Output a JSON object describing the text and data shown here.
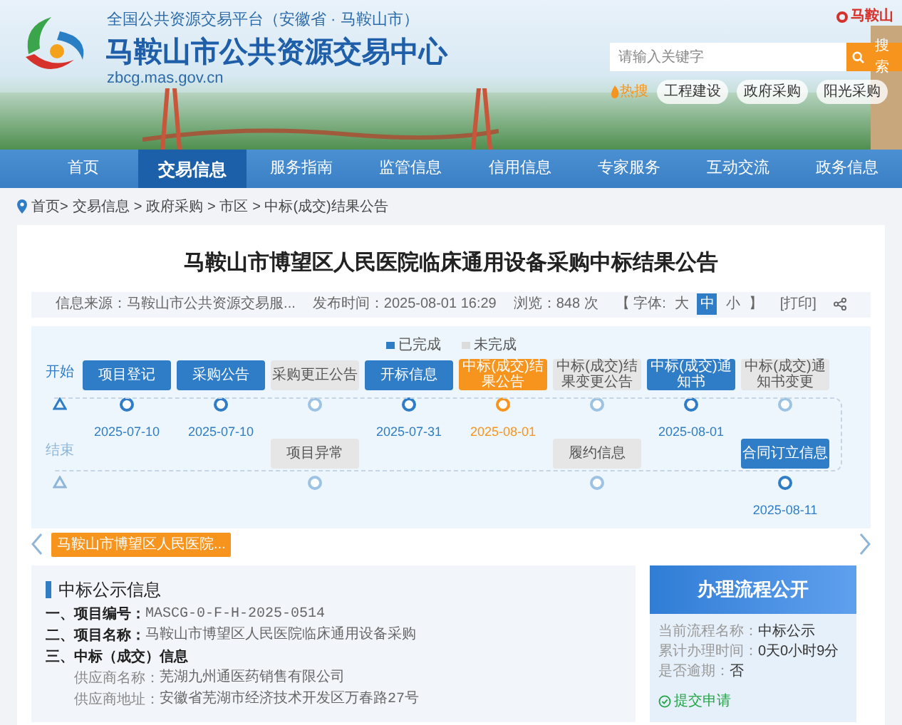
{
  "header": {
    "platform": "全国公共资源交易平台（安徽省 · 马鞍山市）",
    "title": "马鞍山市公共资源交易中心",
    "domain": "zbcg.mas.gov.cn",
    "corner_text": "马鞍山",
    "search": {
      "placeholder": "请输入关键字",
      "button": "搜索"
    },
    "hot_label": "热搜",
    "hot_tags": [
      "工程建设",
      "政府采购",
      "阳光采购"
    ]
  },
  "nav": [
    {
      "label": "首页",
      "selected": false
    },
    {
      "label": "交易信息",
      "selected": true
    },
    {
      "label": "服务指南",
      "selected": false
    },
    {
      "label": "监管信息",
      "selected": false
    },
    {
      "label": "信用信息",
      "selected": false
    },
    {
      "label": "专家服务",
      "selected": false
    },
    {
      "label": "互动交流",
      "selected": false
    },
    {
      "label": "政务信息",
      "selected": false
    }
  ],
  "breadcrumb": [
    "首页>",
    "交易信息",
    "> 政府采购",
    "> 市区",
    "> 中标(成交)结果公告"
  ],
  "article": {
    "title": "马鞍山市博望区人民医院临床通用设备采购中标结果公告",
    "source": "信息来源：马鞍山市公共资源交易服...",
    "published": "发布时间：2025-08-01 16:29",
    "views": "浏览：848 次",
    "font_label": "【 字体:",
    "font_sizes": [
      {
        "label": "大",
        "selected": false
      },
      {
        "label": "中",
        "selected": true
      },
      {
        "label": "小",
        "selected": false
      }
    ],
    "font_close": "】",
    "print": "[打印]"
  },
  "timeline": {
    "legend": [
      "已完成",
      "未完成"
    ],
    "start_label": "开始",
    "end_label": "结束",
    "top_steps": [
      {
        "label": "项目登记",
        "done": true,
        "current": false,
        "date": "2025-07-10"
      },
      {
        "label": "采购公告",
        "done": true,
        "current": false,
        "date": "2025-07-10"
      },
      {
        "label": "采购更正公告",
        "done": false,
        "current": false
      },
      {
        "label": "开标信息",
        "done": true,
        "current": false,
        "date": "2025-07-31"
      },
      {
        "label": "中标(成交)结果公告",
        "done": false,
        "current": true,
        "date": "2025-08-01"
      },
      {
        "label": "中标(成交)结果变更公告",
        "done": false,
        "current": false
      },
      {
        "label": "中标(成交)通知书",
        "done": true,
        "current": false,
        "date": "2025-08-01"
      },
      {
        "label": "中标(成交)通知书变更",
        "done": false,
        "current": false
      }
    ],
    "bottom_steps": [
      {
        "label": "项目异常",
        "done": false,
        "current": false
      },
      {
        "label": "履约信息",
        "done": false,
        "current": false
      },
      {
        "label": "合同订立信息",
        "done": true,
        "current": false,
        "date": "2025-08-11"
      }
    ]
  },
  "project_tab": "马鞍山市博望区人民医院...",
  "notice": {
    "heading": "中标公示信息",
    "lines": [
      {
        "kind": "main",
        "label": "一、项目编号：",
        "value": "MASCG-0-F-H-2025-0514"
      },
      {
        "kind": "main",
        "label": "二、项目名称：",
        "value": "马鞍山市博望区人民医院临床通用设备采购"
      },
      {
        "kind": "main",
        "label": "三、中标（成交）信息"
      },
      {
        "kind": "sub",
        "label": "供应商名称：",
        "value": "芜湖九州通医药销售有限公司"
      },
      {
        "kind": "sub",
        "label": "供应商地址：",
        "value": "安徽省芜湖市经济技术开发区万春路27号"
      }
    ]
  },
  "process": {
    "title": "办理流程公开",
    "rows": [
      {
        "label": "当前流程名称：",
        "value": "中标公示"
      },
      {
        "label": "累计办理时间：",
        "value": "0天0小时9分"
      },
      {
        "label": "是否逾期：",
        "value": "否"
      }
    ],
    "step": "提交申请"
  }
}
